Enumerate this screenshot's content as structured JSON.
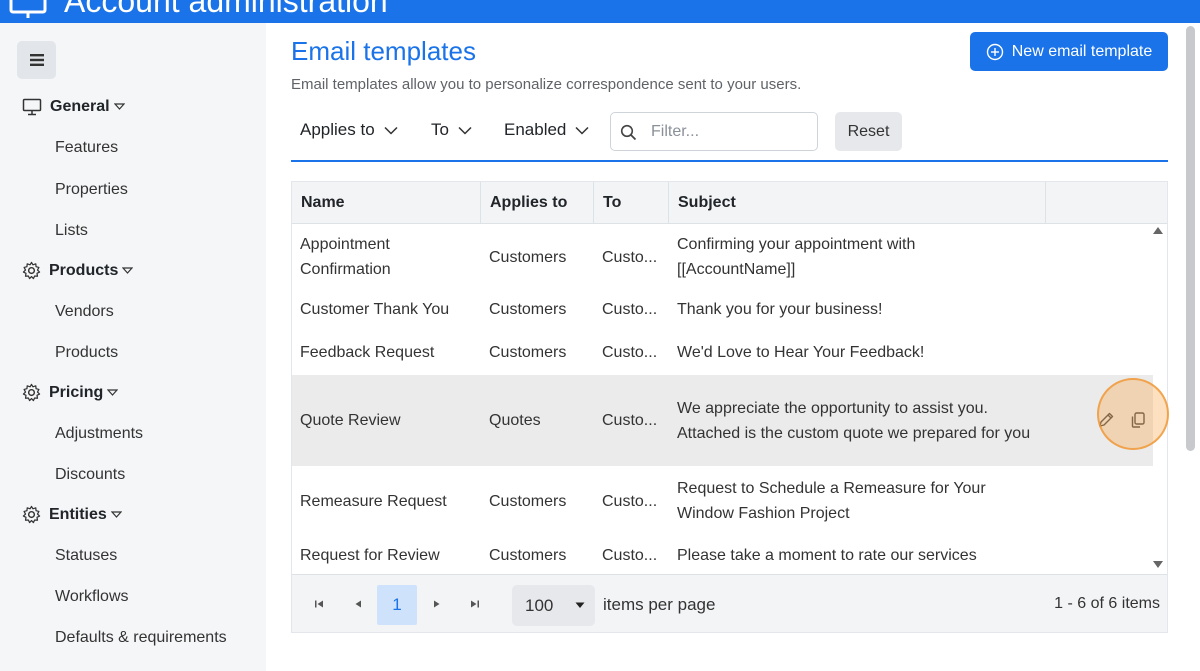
{
  "app": {
    "title": "Account administration"
  },
  "sidebar": {
    "groups": [
      {
        "label": "General",
        "icon": "monitor-icon",
        "items": [
          "Features",
          "Properties",
          "Lists"
        ]
      },
      {
        "label": "Products",
        "icon": "gear-icon",
        "items": [
          "Vendors",
          "Products"
        ]
      },
      {
        "label": "Pricing",
        "icon": "gear-icon",
        "items": [
          "Adjustments",
          "Discounts"
        ]
      },
      {
        "label": "Entities",
        "icon": "gear-icon",
        "items": [
          "Statuses",
          "Workflows",
          "Defaults & requirements"
        ]
      }
    ]
  },
  "page": {
    "title": "Email templates",
    "subtitle": "Email templates allow you to personalize correspondence sent to your users.",
    "new_button": "New email template"
  },
  "filters": {
    "applies_to": "Applies to",
    "to": "To",
    "enabled": "Enabled",
    "search_placeholder": "Filter...",
    "reset": "Reset"
  },
  "table": {
    "columns": [
      "Name",
      "Applies to",
      "To",
      "Subject"
    ],
    "rows": [
      {
        "name": "Appointment Confirmation",
        "applies_to": "Customers",
        "to": "Custo...",
        "subject": "Confirming your appointment with [[AccountName]]"
      },
      {
        "name": "Customer Thank You",
        "applies_to": "Customers",
        "to": "Custo...",
        "subject": "Thank you for your business!"
      },
      {
        "name": "Feedback Request",
        "applies_to": "Customers",
        "to": "Custo...",
        "subject": "We'd Love to Hear Your Feedback!"
      },
      {
        "name": "Quote Review",
        "applies_to": "Quotes",
        "to": "Custo...",
        "subject": "We appreciate the opportunity to assist you. Attached is the custom quote we prepared for you"
      },
      {
        "name": "Remeasure Request",
        "applies_to": "Customers",
        "to": "Custo...",
        "subject": "Request to Schedule a Remeasure for Your Window Fashion Project"
      },
      {
        "name": "Request for Review",
        "applies_to": "Customers",
        "to": "Custo...",
        "subject": "Please take a moment to rate our services"
      }
    ]
  },
  "pager": {
    "current_page": "1",
    "page_size": "100",
    "page_size_label": "items per page",
    "info": "1 - 6 of 6 items"
  },
  "colors": {
    "accent": "#1a73e8",
    "sidebar_bg": "#f5f6f8",
    "highlight_row": "#ebebeb"
  }
}
